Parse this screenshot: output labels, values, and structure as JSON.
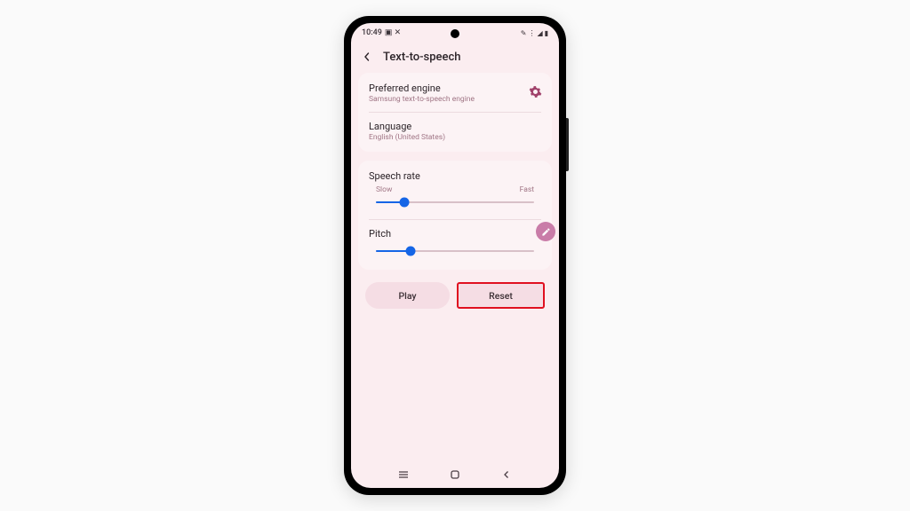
{
  "status": {
    "time": "10:49",
    "icons_left": "▣ ✕",
    "icons_right": "✎ ⋮ ◢ ▮"
  },
  "header": {
    "title": "Text-to-speech"
  },
  "engine": {
    "label": "Preferred engine",
    "value": "Samsung text-to-speech engine"
  },
  "language": {
    "label": "Language",
    "value": "English (United States)"
  },
  "speech_rate": {
    "label": "Speech rate",
    "min_label": "Slow",
    "max_label": "Fast",
    "percent": 18
  },
  "pitch": {
    "label": "Pitch",
    "percent": 22
  },
  "buttons": {
    "play": "Play",
    "reset": "Reset"
  }
}
